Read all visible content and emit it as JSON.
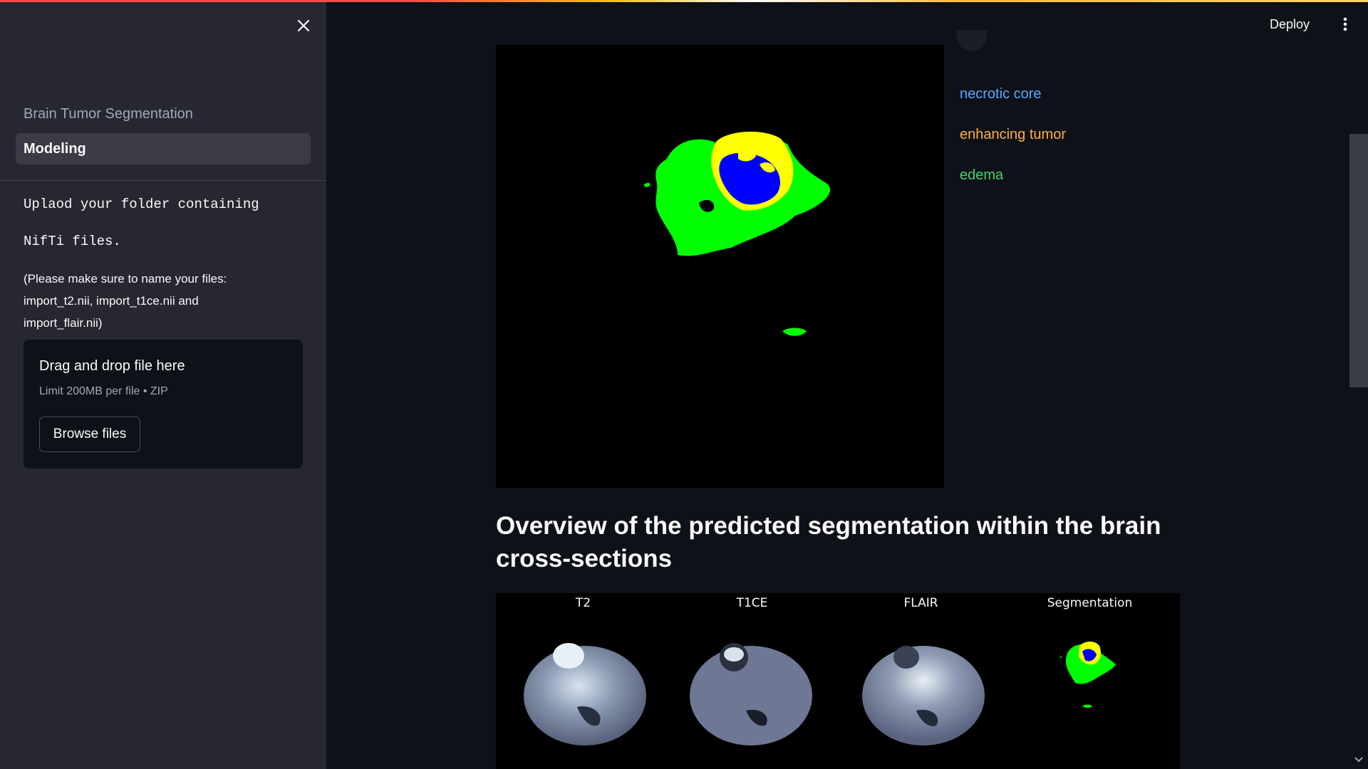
{
  "sidebar": {
    "nav_items": [
      {
        "label": "Brain Tumor Segmentation",
        "active": false
      },
      {
        "label": "Modeling",
        "active": true
      }
    ],
    "instructions_line1": "Uplaod your folder containing",
    "instructions_line2": "NifTi files.",
    "note_lines": [
      "(Please make sure to name your files:",
      "import_t2.nii, import_t1ce.nii and",
      "import_flair.nii)"
    ],
    "uploader": {
      "title": "Drag and drop file here",
      "limit": "Limit 200MB per file • ZIP",
      "browse_label": "Browse files"
    }
  },
  "header": {
    "deploy_label": "Deploy"
  },
  "legend": {
    "items": [
      {
        "label": "necrotic core",
        "color": "#5aa9ff"
      },
      {
        "label": "enhancing tumor",
        "color": "#ffb340"
      },
      {
        "label": "edema",
        "color": "#3dd56d"
      }
    ]
  },
  "main": {
    "heading": "Overview of the predicted segmentation within the brain cross-sections",
    "panels": [
      {
        "label": "T2"
      },
      {
        "label": "T1CE"
      },
      {
        "label": "FLAIR"
      },
      {
        "label": "Segmentation"
      }
    ]
  },
  "colors": {
    "background": "#0e1117",
    "sidebar": "#262730",
    "segmentation_edema": "#00ff00",
    "segmentation_enhancing": "#ffff00",
    "segmentation_necrotic": "#0000ff"
  }
}
